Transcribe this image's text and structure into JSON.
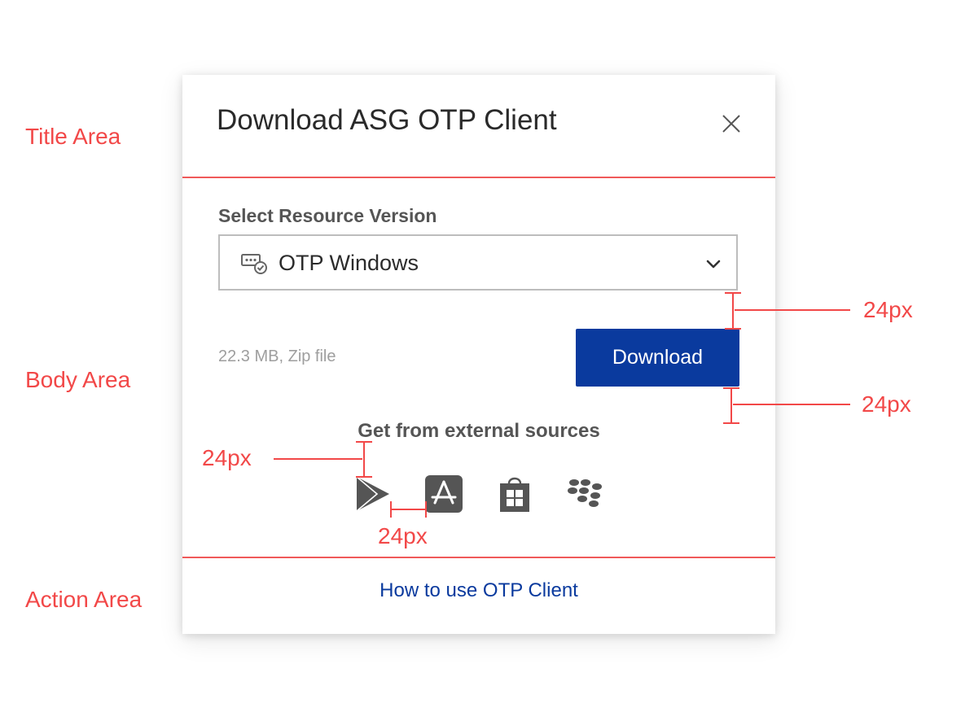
{
  "annotations": {
    "title_area": "Title Area",
    "body_area": "Body Area",
    "action_area": "Action Area",
    "spacing_labels": [
      "24px",
      "24px",
      "24px",
      "24px"
    ],
    "color": "#f24848"
  },
  "dialog": {
    "title": "Download ASG OTP Client",
    "close_icon": "close-icon",
    "field_label": "Select Resource Version",
    "select": {
      "value": "OTP Windows",
      "icon": "desktop-check-icon"
    },
    "file_info": "22.3 MB, Zip file",
    "download_label": "Download",
    "external_title": "Get from external sources",
    "stores": [
      "google-play-icon",
      "app-store-icon",
      "windows-store-icon",
      "blackberry-icon"
    ],
    "action_link": "How to use OTP Client",
    "accent_color": "#0a3a9e"
  }
}
